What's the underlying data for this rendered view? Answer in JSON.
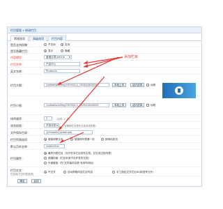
{
  "breadcrumb": "栏目管理 » 修改栏目",
  "tabs": [
    "常规选项",
    "高级选项",
    "栏目内容"
  ],
  "form": {
    "rows": [
      {
        "label": "是否支持投稿：",
        "options": [
          "不支持",
          "支持"
        ],
        "selected": 1
      },
      {
        "label": "是否隐藏栏目：",
        "options": [
          "显示",
          "隐藏"
        ],
        "selected": 0
      },
      {
        "label": "内容模型：",
        "value": "普通文章|article"
      },
      {
        "label": "栏目名称：",
        "value": "产品中心"
      },
      {
        "label": "英文名称：",
        "value": "Products"
      },
      {
        "label": "栏目大图：",
        "value": "/uploads/allimg/190524-1_1526128245H7",
        "buttons": [
          "本地上传",
          "站内选择"
        ],
        "remote_label": "远程"
      },
      {
        "label": "栏目小图：",
        "value": "/uploads/allimg/190524-1_1526128246S3",
        "buttons": [
          "本地上传",
          "站内选择"
        ],
        "remote_label": "远程"
      },
      {
        "label": "排序顺序：",
        "value": "2",
        "hint": "（由低 -> 高）"
      },
      {
        "label": "浏览权限：",
        "value": "开放浏览",
        "hint": "（仅限制栏目里的文档浏览权限）"
      },
      {
        "label": "文件保存目录：",
        "value": "{cmspath}/products"
      },
      {
        "label": "栏目列表选项：",
        "options": [
          "链接到默认页",
          "链接到列表第一页",
          "使用动态页"
        ],
        "selected": 0
      },
      {
        "label": "默认页的名称：",
        "value": "index.html"
      },
      {
        "label": "栏目属性：",
        "options": [
          "最终列表栏目（允许在本栏目发布文档，并生成文档列表）",
          "频道封面（栏目本身不允许发布文档）",
          "外部链接（在\"文件保存目录\"处填写网址）"
        ],
        "selected": 0
      },
      {
        "label": "栏目交叉：",
        "hint2": "仅适用[栏目列表选项]",
        "options": [
          "不交叉",
          "自动获取同名栏目内容",
          "手工指定交叉栏目ID(用逗号分开)"
        ],
        "selected": 0
      }
    ]
  },
  "buttons": {
    "submit": "确定",
    "back": "返回"
  },
  "annotation": "添加栏目",
  "colors": {
    "accent": "#e53935",
    "tab_border": "#c9d7e6",
    "link": "#1a4f8a"
  }
}
